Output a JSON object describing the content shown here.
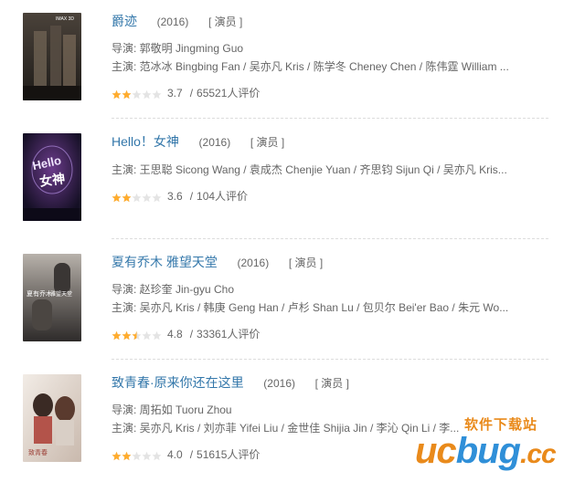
{
  "movies": [
    {
      "title": "爵迹",
      "year": "(2016)",
      "role": "[ 演员 ]",
      "director": "导演: 郭敬明 Jingming Guo",
      "cast": "主演: 范冰冰 Bingbing Fan / 吴亦凡 Kris / 陈学冬 Cheney Chen / 陈伟霆 William ...",
      "rating": "3.7",
      "stars": 2,
      "votes": "65521人评价",
      "poster_text": "IMAX 3D",
      "poster_colors": [
        "#2a2623",
        "#6a5f52"
      ]
    },
    {
      "title": "Hello！女神",
      "year": "(2016)",
      "role": "[ 演员 ]",
      "director": "",
      "cast": "主演: 王思聪 Sicong Wang / 袁成杰 Chenjie Yuan / 齐思钧 Sijun Qi / 吴亦凡 Kris...",
      "rating": "3.6",
      "stars": 2,
      "votes": "104人评价",
      "poster_text": "Hello 女神",
      "poster_colors": [
        "#1a1430",
        "#5a2e7a"
      ]
    },
    {
      "title": "夏有乔木 雅望天堂",
      "year": "(2016)",
      "role": "[ 演员 ]",
      "director": "导演: 赵珍奎 Jin-gyu Cho",
      "cast": "主演: 吴亦凡 Kris / 韩庚 Geng Han / 卢杉 Shan Lu / 包贝尔 Bei'er Bao / 朱元 Wo...",
      "rating": "4.8",
      "stars": 2.5,
      "votes": "33361人评价",
      "poster_text": "夏有乔木 雅望天堂",
      "poster_colors": [
        "#3d3a3a",
        "#9c9590"
      ]
    },
    {
      "title": "致青春·原来你还在这里",
      "year": "(2016)",
      "role": "[ 演员 ]",
      "director": "导演: 周拓如 Tuoru Zhou",
      "cast": "主演: 吴亦凡 Kris / 刘亦菲 Yifei Liu / 金世佳 Shijia Jin / 李沁 Qin Li / 李...",
      "rating": "4.0",
      "stars": 2,
      "votes": "51615人评价",
      "poster_text": "致青春 原来你还在这里",
      "poster_colors": [
        "#e8e2dc",
        "#a45a48"
      ]
    }
  ],
  "separator": "/",
  "watermark": {
    "cn": "软件下载站",
    "uc": "uc",
    "bug": "bug",
    "cc": ".cc"
  },
  "colors": {
    "title": "#3377aa",
    "star": "#ffac2d",
    "star_empty": "#e4e4e4"
  }
}
